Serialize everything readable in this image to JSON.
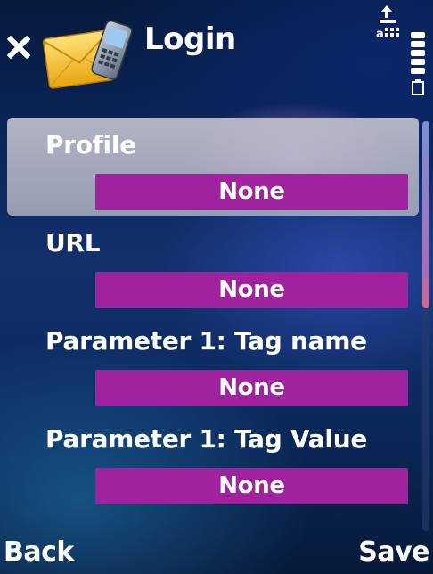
{
  "header": {
    "title": "Login",
    "close_icon": "close-icon",
    "app_icon": "mail-phone-icon"
  },
  "status": {
    "connection_icon": "packet-data-icon",
    "battery_icon": "battery-icon"
  },
  "list": {
    "items": [
      {
        "label": "Profile",
        "value": "None",
        "selected": true
      },
      {
        "label": "URL",
        "value": "None",
        "selected": false
      },
      {
        "label": "Parameter 1: Tag name",
        "value": "None",
        "selected": false
      },
      {
        "label": "Parameter 1: Tag Value",
        "value": "None",
        "selected": false
      }
    ]
  },
  "softkeys": {
    "left": "Back",
    "right": "Save"
  },
  "colors": {
    "value_field": "#a0229e",
    "selection": "#c4c4cc"
  }
}
